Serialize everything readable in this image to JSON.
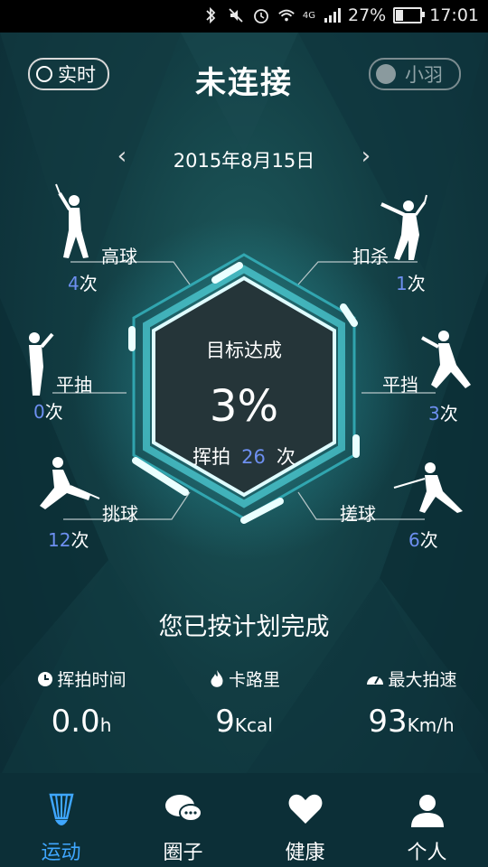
{
  "status_bar": {
    "battery": "27%",
    "time": "17:01",
    "network": "4G",
    "battery_level": 0.27,
    "icons": [
      "bluetooth-icon",
      "mute-icon",
      "alarm-icon",
      "wifi-icon",
      "signal-icon",
      "battery-icon"
    ]
  },
  "header": {
    "realtime_label": "实时",
    "title": "未连接",
    "device_label": "小羽"
  },
  "date_nav": {
    "prev": "‹",
    "date": "2015年8月15日",
    "next": "›"
  },
  "strokes": [
    {
      "label": "高球",
      "count": "4",
      "unit": "次"
    },
    {
      "label": "扣杀",
      "count": "1",
      "unit": "次"
    },
    {
      "label": "平抽",
      "count": "0",
      "unit": "次"
    },
    {
      "label": "平挡",
      "count": "3",
      "unit": "次"
    },
    {
      "label": "挑球",
      "count": "12",
      "unit": "次"
    },
    {
      "label": "搓球",
      "count": "6",
      "unit": "次"
    }
  ],
  "goal": {
    "label": "目标达成",
    "percent": "3%",
    "swing_label": "挥拍",
    "swing_count": "26",
    "swing_unit": "次"
  },
  "plan_text": "您已按计划完成",
  "stats": {
    "time": {
      "label": "挥拍时间",
      "value": "0.0",
      "unit": "h"
    },
    "calories": {
      "label": "卡路里",
      "value": "9",
      "unit": "Kcal"
    },
    "speed": {
      "label": "最大拍速",
      "value": "93",
      "unit": "Km/h"
    }
  },
  "tabs": [
    {
      "label": "运动",
      "icon": "shuttlecock-icon"
    },
    {
      "label": "圈子",
      "icon": "chat-bubbles-icon"
    },
    {
      "label": "健康",
      "icon": "heart-icon"
    },
    {
      "label": "个人",
      "icon": "person-icon"
    }
  ],
  "colors": {
    "accent": "#3fa7ff",
    "count": "#6d8ff0",
    "glow": "#5ff6ff"
  }
}
